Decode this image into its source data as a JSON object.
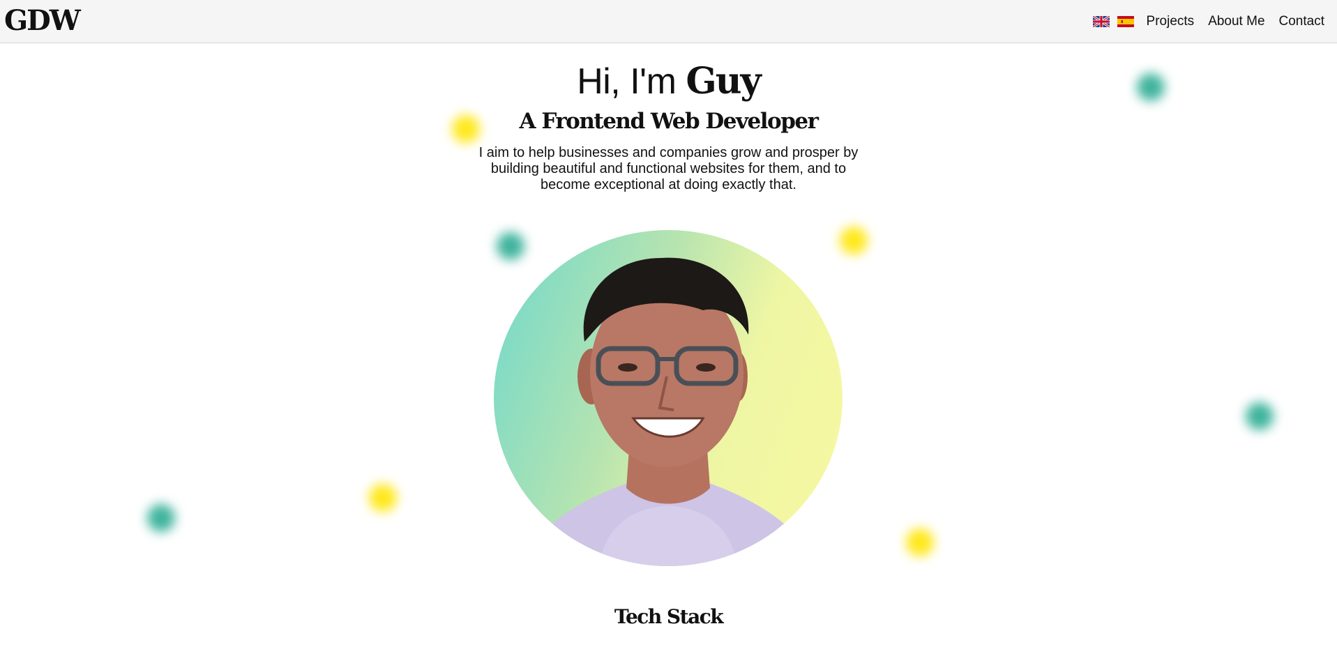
{
  "navbar": {
    "logo": "GDW",
    "languages": [
      {
        "code": "en",
        "icon": "uk-flag-icon"
      },
      {
        "code": "es",
        "icon": "spain-flag-icon"
      }
    ],
    "links": [
      "Projects",
      "About Me",
      "Contact"
    ]
  },
  "hero": {
    "greeting": "Hi, I'm ",
    "name": "Guy",
    "subtitle": "A Frontend Web Developer",
    "description": "I aim to help businesses and companies grow and prosper by building beautiful and functional websites for them, and to become exceptional at doing exactly that."
  },
  "sections": {
    "tech_stack_title": "Tech Stack"
  },
  "colors": {
    "accent_teal": "#3fb39d",
    "accent_yellow": "#ffe81c",
    "navbar_bg": "#f5f5f5"
  }
}
